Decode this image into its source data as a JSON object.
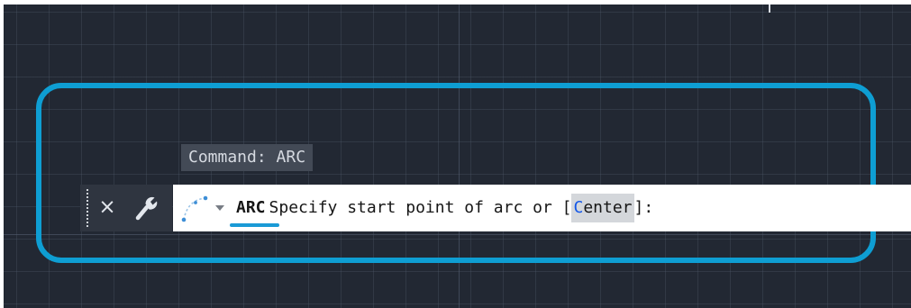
{
  "command_line": {
    "history": "Command: ARC",
    "active_command": "ARC",
    "prompt": "Specify start point of arc or ",
    "bracket_open": "[",
    "option_hotkey": "C",
    "option_rest": "enter",
    "bracket_close": "]",
    "prompt_end": ":",
    "close_glyph": "×"
  },
  "icons": {
    "close": "close-icon",
    "customize": "wrench-icon",
    "recent": "arc-command-icon",
    "dropdown": "caret-down-icon"
  },
  "colors": {
    "canvas_background": "#222833",
    "highlight": "#0e9ed3",
    "option_hotkey": "#1357e8",
    "option_background": "#d4d7db",
    "history_background": "#434a56",
    "underline_accent": "#1a9ad6"
  }
}
